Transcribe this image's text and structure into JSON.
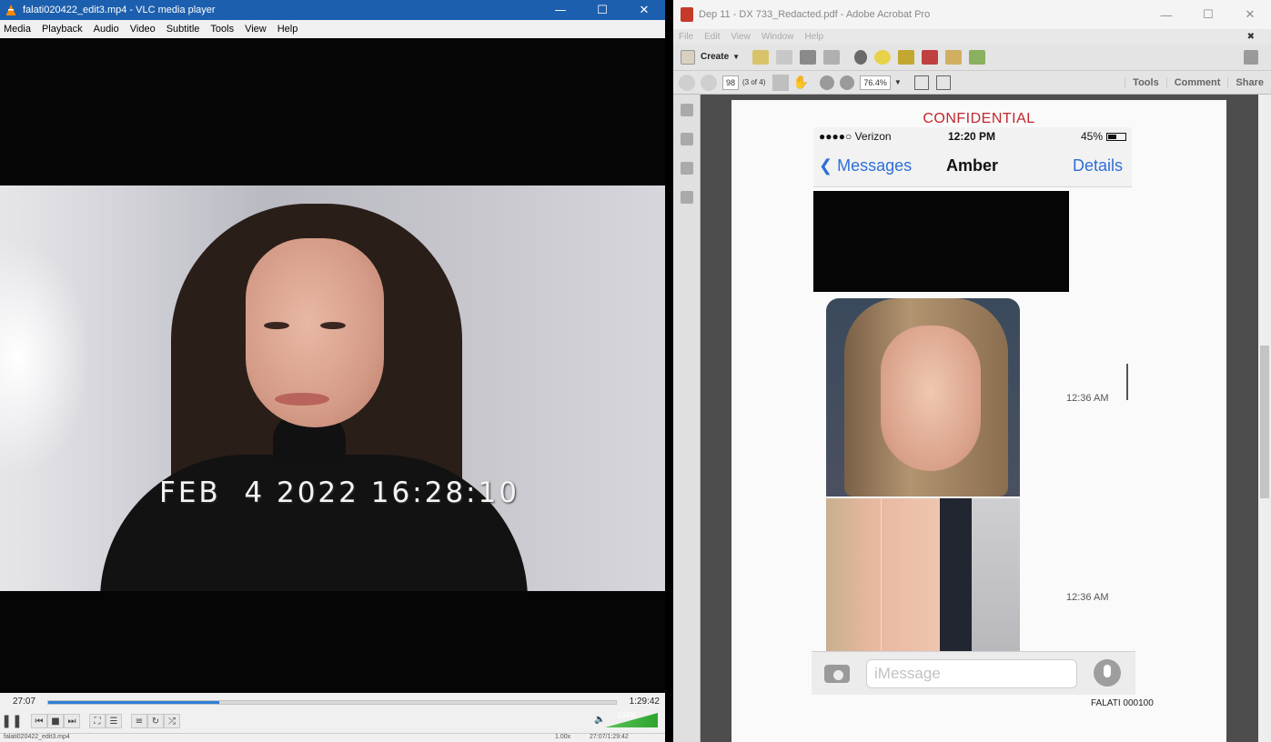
{
  "vlc": {
    "title": "falati020422_edit3.mp4 - VLC media player",
    "menu": [
      "Media",
      "Playback",
      "Audio",
      "Video",
      "Subtitle",
      "Tools",
      "View",
      "Help"
    ],
    "video_timestamp": "FEB  4 2022 16:28:10",
    "time_elapsed": "27:07",
    "time_total": "1:29:42",
    "progress_fraction": 0.302,
    "volume_label": "104%",
    "status_left": "falati020422_edit3.mp4",
    "status_speed": "1.00x",
    "status_time": "27:07/1:29:42"
  },
  "acrobat": {
    "title": "Dep 11 - DX 733_Redacted.pdf - Adobe Acrobat Pro",
    "menu": [
      "File",
      "Edit",
      "View",
      "Window",
      "Help"
    ],
    "create_label": "Create",
    "page_number": "98",
    "page_of": "(3 of 4)",
    "zoom": "76.4%",
    "right_links": [
      "Tools",
      "Comment",
      "Share"
    ]
  },
  "document": {
    "confidential": "CONFIDENTIAL",
    "carrier": "●●●●○ Verizon",
    "time": "12:20 PM",
    "battery": "45%",
    "back_label": "Messages",
    "contact_name": "Amber",
    "details_label": "Details",
    "photo1_time": "12:36 AM",
    "photo2_time": "12:36 AM",
    "imessage_placeholder": "iMessage",
    "bates": "FALATI 000100"
  },
  "colors": {
    "vlc_titlebar": "#1c5fae",
    "seek_fill": "#2e7fd8",
    "confidential_red": "#c0272d",
    "ios_blue": "#2d6fd8"
  }
}
